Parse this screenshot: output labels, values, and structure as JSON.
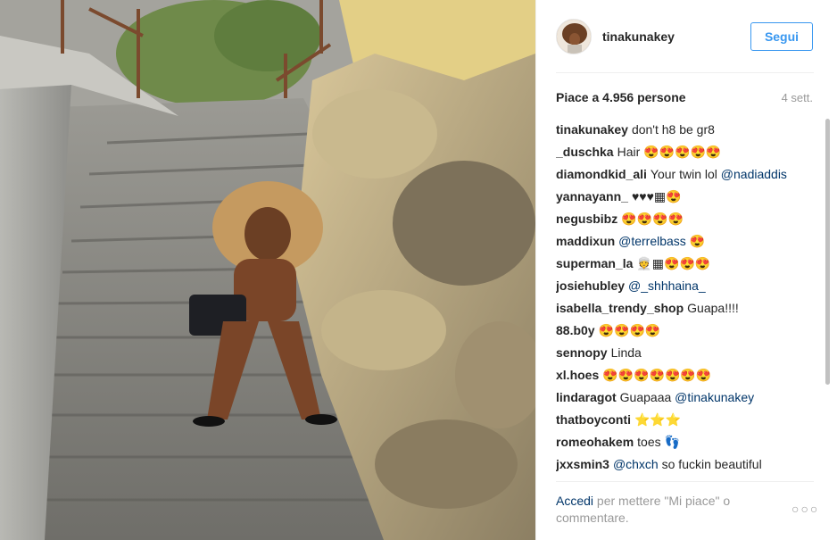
{
  "post": {
    "username": "tinakunakey",
    "follow_label": "Segui",
    "likes": "Piace a 4.956 persone",
    "time": "4 sett."
  },
  "comments": [
    {
      "user": "tinakunakey",
      "text": "don't h8 be gr8"
    },
    {
      "user": "_duschka",
      "text": "Hair 😍😍😍😍😍"
    },
    {
      "user": "diamondkid_ali",
      "text": "Your twin lol ",
      "mention": "@nadiaddis"
    },
    {
      "user": "yannayann_",
      "text": "♥♥♥▦😍"
    },
    {
      "user": "negusbibz",
      "text": "😍😍😍😍"
    },
    {
      "user": "maddixun",
      "text": "",
      "mention": "@terrelbass",
      "after": " 😍"
    },
    {
      "user": "superman_la",
      "text": "👳▦😍😍😍"
    },
    {
      "user": "josiehubley",
      "text": "",
      "mention": "@_shhhaina_"
    },
    {
      "user": "isabella_trendy_shop",
      "text": "Guapa!!!!"
    },
    {
      "user": "88.b0y",
      "text": "😍😍😍😍"
    },
    {
      "user": "sennopy",
      "text": "Linda"
    },
    {
      "user": "xl.hoes",
      "text": "😍😍😍😍😍😍😍"
    },
    {
      "user": "lindaragot",
      "text": "Guapaaa ",
      "mention": "@tinakunakey"
    },
    {
      "user": "thatboyconti",
      "text": "⭐⭐⭐"
    },
    {
      "user": "romeohakem",
      "text": "toes 👣"
    },
    {
      "user": "jxxsmin3",
      "text": "",
      "mention": "@chxch",
      "after": " so fuckin beautiful"
    }
  ],
  "footer": {
    "login_label": "Accedi",
    "text": " per mettere \"Mi piace\" o commentare.",
    "more_icon": "ellipsis-icon"
  }
}
